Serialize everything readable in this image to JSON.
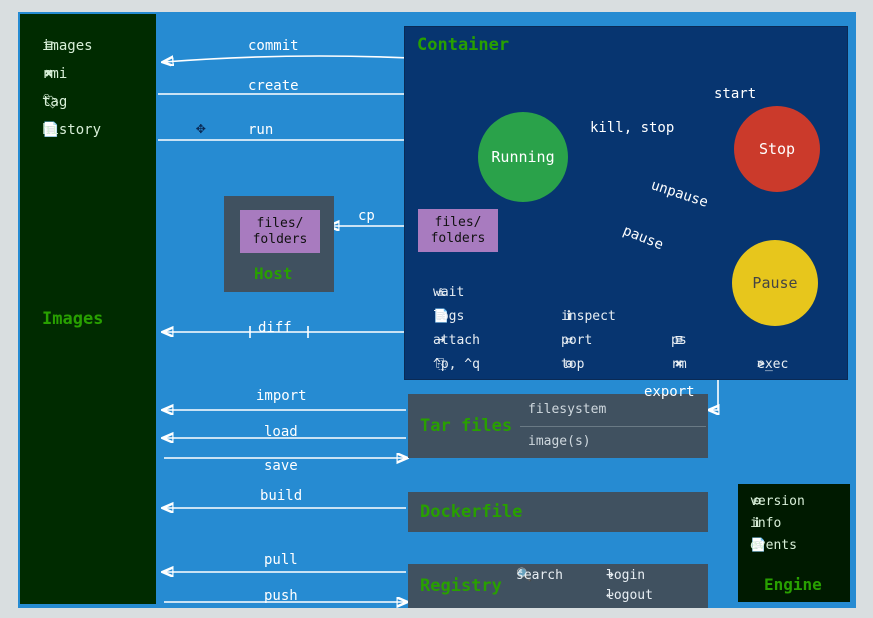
{
  "images_panel": {
    "title": "Images",
    "commands": [
      {
        "icon": "≣",
        "label": "images"
      },
      {
        "icon": "✖",
        "label": "rmi"
      },
      {
        "icon": "🏷",
        "label": "tag"
      },
      {
        "icon": "📄",
        "label": "history"
      }
    ]
  },
  "container_panel": {
    "title": "Container",
    "states": {
      "running": "Running",
      "stop": "Stop",
      "pause": "Pause"
    },
    "files_folders": "files/\nfolders",
    "sub": [
      {
        "icon": "⚓",
        "label": "wait"
      },
      {
        "icon": "📄",
        "label": "logs"
      },
      {
        "icon": "➜",
        "label": "attach"
      },
      {
        "icon": "⎘",
        "label": "^p, ^q"
      },
      {
        "icon": "ℹ",
        "label": "inspect"
      },
      {
        "icon": "⇄",
        "label": "port"
      },
      {
        "icon": "⚙",
        "label": "top"
      },
      {
        "icon": "≣",
        "label": "ps"
      },
      {
        "icon": "✖",
        "label": "rm"
      },
      {
        "icon": ">_",
        "label": "exec"
      }
    ]
  },
  "host": {
    "title": "Host",
    "files_folders": "files/\nfolders"
  },
  "tar": {
    "title": "Tar files",
    "rows": [
      "filesystem",
      "image(s)"
    ]
  },
  "dockerfile": {
    "title": "Dockerfile"
  },
  "registry": {
    "title": "Registry",
    "commands": [
      {
        "icon": "🔍",
        "label": "search"
      },
      {
        "icon": "➜",
        "label": "login"
      },
      {
        "icon": "↩",
        "label": "logout"
      }
    ]
  },
  "engine": {
    "title": "Engine",
    "commands": [
      {
        "icon": "⚙",
        "label": "version"
      },
      {
        "icon": "ℹ",
        "label": "info"
      },
      {
        "icon": "📄",
        "label": "events"
      }
    ]
  },
  "actions": {
    "commit": "commit",
    "create": "create",
    "run": "run",
    "start": "start",
    "kill_stop": "kill, stop",
    "unpause": "unpause",
    "pause": "pause",
    "cp": "cp",
    "diff": "diff",
    "import": "import",
    "export": "export",
    "load": "load",
    "save": "save",
    "build": "build",
    "pull": "pull",
    "push": "push"
  }
}
